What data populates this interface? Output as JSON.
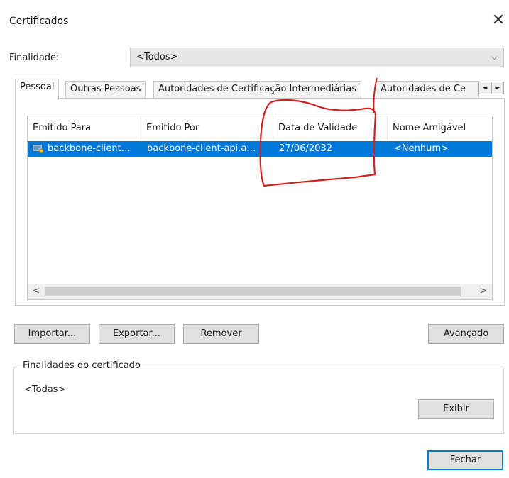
{
  "window": {
    "title": "Certificados",
    "close_icon": "close-icon"
  },
  "purpose": {
    "label": "Finalidade:",
    "selected": "<Todos>"
  },
  "tabs": [
    {
      "label": "Pessoal",
      "active": true
    },
    {
      "label": "Outras Pessoas"
    },
    {
      "label": "Autoridades de Certificação Intermediárias"
    },
    {
      "label": "Autoridades de Ce"
    }
  ],
  "tab_scroll": {
    "left": "◄",
    "right": "►"
  },
  "cert_list": {
    "columns": [
      "Emitido Para",
      "Emitido Por",
      "Data de Validade",
      "Nome Amigável"
    ],
    "rows": [
      {
        "issued_to": "backbone-client…",
        "issued_by": "backbone-client-api.a…",
        "valid_until": "27/06/2032",
        "friendly_name": "<Nenhum>",
        "selected": true
      }
    ]
  },
  "buttons": {
    "import": "Importar...",
    "export": "Exportar...",
    "remove": "Remover",
    "advanced": "Avançado",
    "view": "Exibir",
    "close": "Fechar"
  },
  "cert_purposes": {
    "title": "Finalidades do certificado",
    "value": "<Todas>"
  },
  "colors": {
    "selection": "#0078d7",
    "annotation": "#d02020",
    "button_face": "#e1e1e1"
  }
}
